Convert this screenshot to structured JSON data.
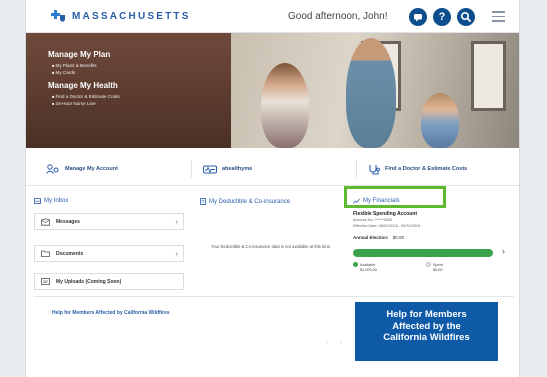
{
  "header": {
    "brand": "MASSACHUSETTS",
    "greeting": "Good afternoon, John!",
    "icons": [
      "chat-icon",
      "help-icon",
      "search-icon",
      "menu-icon"
    ],
    "help_symbol": "?",
    "brand_color": "#0d4f8e"
  },
  "hero": {
    "plan_title": "Manage My Plan",
    "plan_items": [
      "My Plans & Benefits",
      "My Cards"
    ],
    "health_title": "Manage My Health",
    "health_items": [
      "Find a Doctor & Estimate Costs",
      "24-Hour Nurse Line"
    ]
  },
  "quick_links": [
    {
      "label": "Manage My Account",
      "icon": "account-icon"
    },
    {
      "label": "ahealthyme",
      "icon": "ahealthyme-icon"
    },
    {
      "label": "Find a Doctor & Estimate Costs",
      "icon": "stethoscope-icon"
    }
  ],
  "sections": {
    "inbox_title": "My Inbox",
    "deductible_title": "My Deductible & Co-insurance",
    "financials_title": "My Financials"
  },
  "inbox": {
    "items": [
      {
        "label": "Messages",
        "icon": "messages-icon"
      },
      {
        "label": "Documents",
        "icon": "folder-icon"
      },
      {
        "label": "My Uploads (Coming Soon)",
        "icon": "upload-icon"
      }
    ]
  },
  "deductible": {
    "message": "Your Deductible & Co-insurance data is not available at this time."
  },
  "financials": {
    "account_title": "Flexible Spending Account",
    "account_no": "Account No: ******5000",
    "effective": "Effective Date: 06/01/2018 - 05/31/2019",
    "election_label": "Annual Election:",
    "election_value": "$0.00",
    "available_label": "Available",
    "available_value": "$1,000.00",
    "spent_label": "Spent",
    "spent_value": "$0.00",
    "available_fraction": 1.0,
    "bar_color": "#3aa34a"
  },
  "bottom": {
    "help_link": "Help for Members Affected by California Wildfires",
    "banner_line1": "Help for Members",
    "banner_line2": "Affected by the",
    "banner_line3": "California Wildfires",
    "pager_prev": "‹",
    "pager_next": "›"
  }
}
